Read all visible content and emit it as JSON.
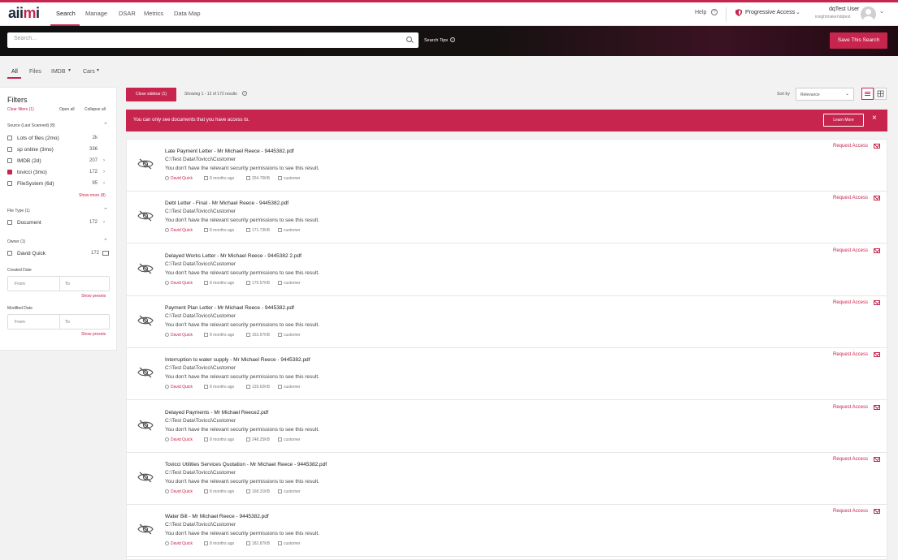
{
  "app": {
    "logo": "aiimi"
  },
  "nav": {
    "items": [
      "Search",
      "Manage",
      "DSAR",
      "Metrics",
      "Data Map"
    ],
    "help": "Help",
    "progressive_access": "Progressive Access",
    "user_name": "dqTest User",
    "user_email": "insightmaker\\dqtest"
  },
  "search": {
    "placeholder": "Search...",
    "value": "",
    "tips_label": "Search Tips",
    "save_label": "Save This Search"
  },
  "tabs": [
    "All",
    "Files",
    "IMDB",
    "Cars"
  ],
  "filters": {
    "title": "Filters",
    "clear": "Clear filters (1)",
    "open_all": "Open all",
    "collapse_all": "Collapse all",
    "source": {
      "header": "Source (Last Scanned) (8)",
      "items": [
        {
          "label": "Lots of files (2mo)",
          "count": "2k",
          "checked": false
        },
        {
          "label": "sp online (3mo)",
          "count": "336",
          "checked": false
        },
        {
          "label": "IMDB (2d)",
          "count": "207",
          "checked": false
        },
        {
          "label": "tovicci (3mo)",
          "count": "172",
          "checked": true
        },
        {
          "label": "FileSystem (6d)",
          "count": "95",
          "checked": false
        }
      ],
      "show_more": "Show more (8)"
    },
    "file_type": {
      "header": "File Type (1)",
      "items": [
        {
          "label": "Document",
          "count": "172",
          "checked": false
        }
      ]
    },
    "owner": {
      "header": "Owner (1)",
      "items": [
        {
          "label": "David Quick",
          "count": "172",
          "checked": false
        }
      ]
    },
    "created_date": {
      "label": "Created Date",
      "from": "From",
      "to": "To",
      "presets": "Show presets"
    },
    "modified_date": {
      "label": "Modified Date",
      "from": "From",
      "to": "To",
      "presets": "Show presets"
    }
  },
  "toolbar": {
    "close_sidebar": "Close sidebar (1)",
    "showing": "Showing 1 - 12 of 172 results",
    "sort_label": "Sort by",
    "sort_value": "Relevance"
  },
  "alert": {
    "message": "You can only see documents that you have access to.",
    "learn_more": "Learn More"
  },
  "results": [
    {
      "title": "Late Payment Letter - Mr Michael Reece - 9445382.pdf",
      "path": "C:\\Test Data\\Tovicci\\Customer",
      "message": "You don't have the relevant security permissions to see this result.",
      "owner": "David Quick",
      "modified": "8 months ago",
      "size": "254.70KB",
      "folder": "customer",
      "request": "Request Access"
    },
    {
      "title": "Debt Letter - Final - Mr Michael Reece - 9445382.pdf",
      "path": "C:\\Test Data\\Tovicci\\Customer",
      "message": "You don't have the relevant security permissions to see this result.",
      "owner": "David Quick",
      "modified": "8 months ago",
      "size": "171.73KB",
      "folder": "customer",
      "request": "Request Access"
    },
    {
      "title": "Delayed Works Letter - Mr Michael Reece - 9445382 2.pdf",
      "path": "C:\\Test Data\\Tovicci\\Customer",
      "message": "You don't have the relevant security permissions to see this result.",
      "owner": "David Quick",
      "modified": "8 months ago",
      "size": "175.57KB",
      "folder": "customer",
      "request": "Request Access"
    },
    {
      "title": "Payment Plan Letter - Mr Michael Reece - 9445382.pdf",
      "path": "C:\\Test Data\\Tovicci\\Customer",
      "message": "You don't have the relevant security permissions to see this result.",
      "owner": "David Quick",
      "modified": "8 months ago",
      "size": "163.67KB",
      "folder": "customer",
      "request": "Request Access"
    },
    {
      "title": "Interruption to water supply - Mr Michael Reece - 9445382.pdf",
      "path": "C:\\Test Data\\Tovicci\\Customer",
      "message": "You don't have the relevant security permissions to see this result.",
      "owner": "David Quick",
      "modified": "8 months ago",
      "size": "129.62KB",
      "folder": "customer",
      "request": "Request Access"
    },
    {
      "title": "Delayed Payments - Mr Michael Reece2.pdf",
      "path": "C:\\Test Data\\Tovicci\\Customer",
      "message": "You don't have the relevant security permissions to see this result.",
      "owner": "David Quick",
      "modified": "8 months ago",
      "size": "248.25KB",
      "folder": "customer",
      "request": "Request Access"
    },
    {
      "title": "Tovicci Utilities Services Quotation - Mr Michael Reece - 9445382.pdf",
      "path": "C:\\Test Data\\Tovicci\\Customer",
      "message": "You don't have the relevant security permissions to see this result.",
      "owner": "David Quick",
      "modified": "8 months ago",
      "size": "168.31KB",
      "folder": "customer",
      "request": "Request Access"
    },
    {
      "title": "Water Bill - Mr Michael Reece - 9445382.pdf",
      "path": "C:\\Test Data\\Tovicci\\Customer",
      "message": "You don't have the relevant security permissions to see this result.",
      "owner": "David Quick",
      "modified": "8 months ago",
      "size": "182.87KB",
      "folder": "customer",
      "request": "Request Access"
    }
  ],
  "colors": {
    "accent": "#c7254e",
    "text": "#333333"
  },
  "icons": [
    "search-icon",
    "help-icon",
    "shield-icon",
    "chevron-down-icon",
    "avatar",
    "info-icon",
    "list-view-icon",
    "grid-view-icon",
    "close-icon",
    "eye-off-icon",
    "user-icon",
    "calendar-icon",
    "file-icon",
    "folder-icon",
    "mail-icon",
    "calendar-picker-icon"
  ]
}
